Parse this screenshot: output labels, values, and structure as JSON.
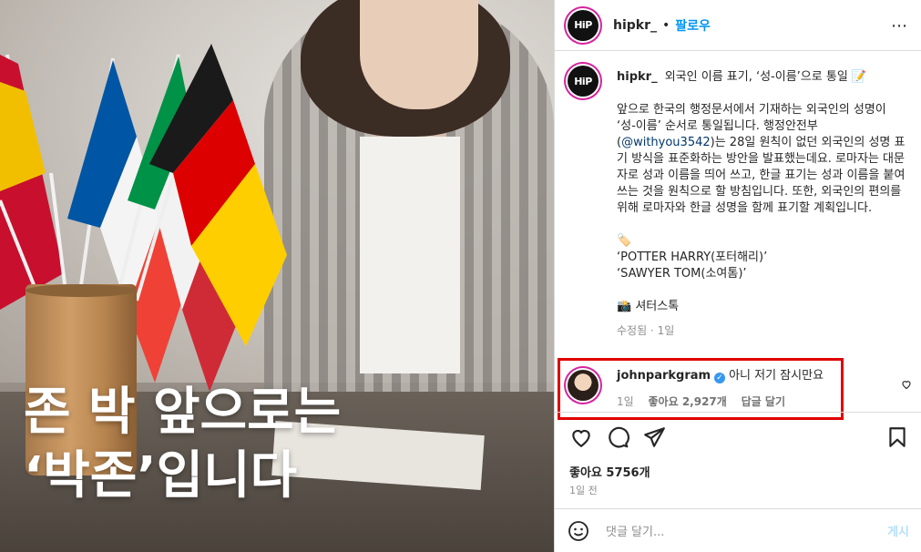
{
  "photo": {
    "overlay_line1": "존 박 앞으로는",
    "overlay_line2": "‘박존’입니다"
  },
  "header": {
    "avatar_text": "HiP",
    "username": "hipkr_",
    "separator": "•",
    "follow_label": "팔로우",
    "more_icon": "⋯"
  },
  "caption": {
    "username": "hipkr_",
    "title": "외국인 이름 표기, ‘성-이름’으로 통일 📝",
    "paragraph_start": "앞으로 한국의 행정문서에서 기재하는 외국인의 성명이 ‘성-이름’ 순서로 통일됩니다. 행정안전부(",
    "mention": "@withyou3542",
    "paragraph_end": ")는 28일 원칙이 없던 외국인의 성명 표기 방식을 표준화하는 방안을 발표했는데요. 로마자는 대문자로 성과 이름을 띄어 쓰고, 한글 표기는 성과 이름을 붙여 쓰는 것을 원칙으로 할 방침입니다. 또한, 외국인의 편의를 위해 로마자와 한글 성명을 함께 표기할 계획입니다.",
    "tag_emoji": "🏷️",
    "example1": "‘POTTER HARRY(포터해리)’",
    "example2": "‘SAWYER TOM(소여톰)’",
    "credit_emoji": "📸",
    "credit": "셔터스톡",
    "meta": "수정됨 · 1일"
  },
  "comment": {
    "username": "johnparkgram",
    "verified_icon": "✓",
    "text": "아니 저기 잠시만요",
    "age": "1일",
    "likes": "좋아요 2,927개",
    "reply": "답글 달기"
  },
  "actions": {
    "likes_count": "좋아요 5756개",
    "date": "1일 전"
  },
  "add_comment": {
    "emoji_icon": "☺",
    "placeholder": "댓글 달기...",
    "post_label": "게시"
  },
  "colors": {
    "link_blue": "#0095f6",
    "highlight_red": "#e00000",
    "story_ring": "#d6249f"
  }
}
